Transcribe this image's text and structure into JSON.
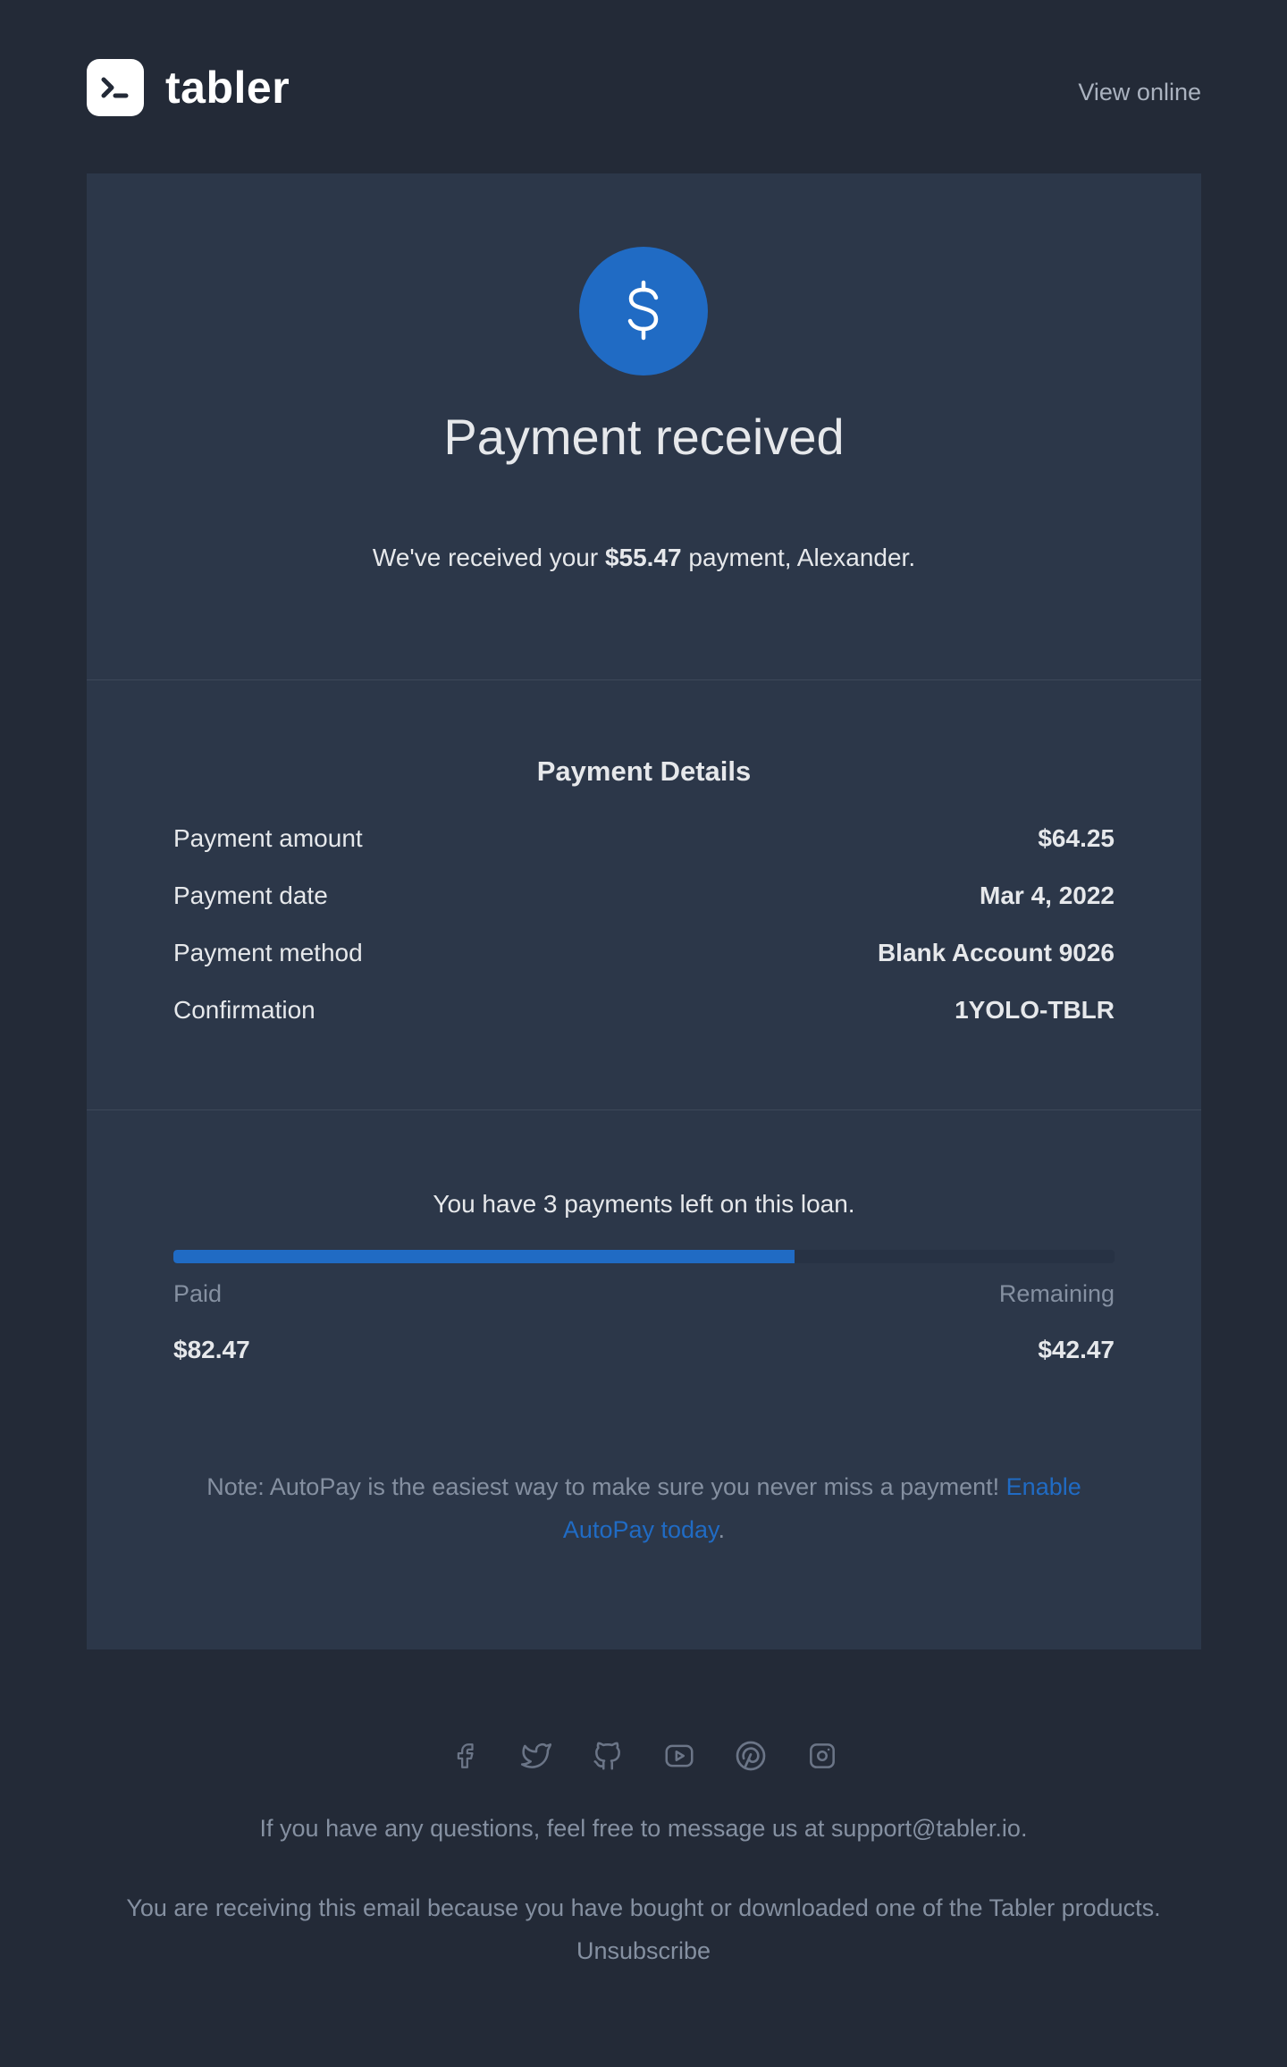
{
  "header": {
    "logo_text": "tabler",
    "view_online": "View online"
  },
  "hero": {
    "icon": "dollar-icon",
    "title": "Payment received",
    "lead_prefix": "We've received your ",
    "lead_amount": "$55.47",
    "lead_suffix": " payment, Alexander."
  },
  "details": {
    "title": "Payment Details",
    "rows": [
      {
        "label": "Payment amount",
        "value": "$64.25"
      },
      {
        "label": "Payment date",
        "value": "Mar 4, 2022"
      },
      {
        "label": "Payment method",
        "value": "Blank Account 9026"
      },
      {
        "label": "Confirmation",
        "value": "1YOLO-TBLR"
      }
    ]
  },
  "loan": {
    "text": "You have 3 payments left on this loan.",
    "progress_fraction": 0.66,
    "paid_label": "Paid",
    "paid_value": "$82.47",
    "remaining_label": "Remaining",
    "remaining_value": "$42.47"
  },
  "note": {
    "text": "Note: AutoPay is the easiest way to make sure you never miss a payment! ",
    "link": "Enable AutoPay today",
    "end": "."
  },
  "footer": {
    "social_icons": [
      "facebook-icon",
      "twitter-icon",
      "github-icon",
      "youtube-icon",
      "pinterest-icon",
      "instagram-icon"
    ],
    "questions": "If you have any questions, feel free to message us at support@tabler.io.",
    "receiving": "You are receiving this email because you have bought or downloaded one of the Tabler products.",
    "unsubscribe": "Unsubscribe"
  },
  "colors": {
    "background": "#232a37",
    "card": "#2c3749",
    "accent": "#206bc4",
    "muted": "#8590a1"
  }
}
